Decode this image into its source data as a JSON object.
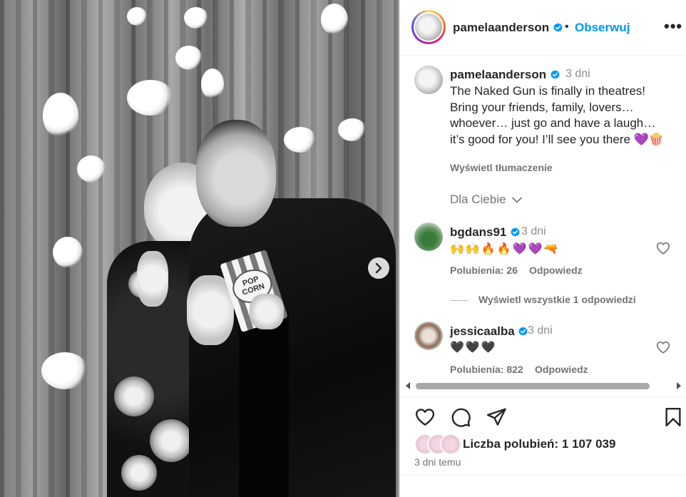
{
  "post": {
    "carousel_next_icon": "chevron-right-icon",
    "popcorn_box_label": "POP CORN"
  },
  "header": {
    "username": "pamelaanderson",
    "verified_icon": "verified-badge-icon",
    "separator": "•",
    "follow_label": "Obserwuj",
    "more_icon": "more-options-icon",
    "more_label": "•••"
  },
  "caption": {
    "username": "pamelaanderson",
    "time": "3 dni",
    "text": "The Naked Gun is finally in theatres! Bring your friends, family, lovers… whoever… just go and have a laugh… it’s good for you! I’ll see you there 💜🍿",
    "translate_label": "Wyświetl tłumaczenie"
  },
  "sort": {
    "label": "Dla Ciebie",
    "chevron": "⌄"
  },
  "comments": [
    {
      "username": "bgdans91",
      "time": "3 dni",
      "text": "🙌🙌🔥🔥💜💜🔫",
      "likes": "Polubienia: 26",
      "reply_label": "Odpowiedz"
    },
    {
      "username": "jessicaalba",
      "time": "3 dni",
      "text": "🖤🖤🖤",
      "likes": "Polubienia: 822",
      "reply_label": "Odpowiedz"
    }
  ],
  "view_replies_label": "Wyświetl wszystkie 1 odpowiedzi",
  "actions": {
    "like_icon": "heart-icon",
    "comment_icon": "comment-icon",
    "share_icon": "send-icon",
    "save_icon": "bookmark-icon"
  },
  "likes_summary": "Liczba polubień: 1 107 039",
  "post_date": "3 dni temu",
  "colors": {
    "accent": "#0095f6",
    "verified": "#0095f6",
    "text": "#262626",
    "muted": "#737373"
  }
}
